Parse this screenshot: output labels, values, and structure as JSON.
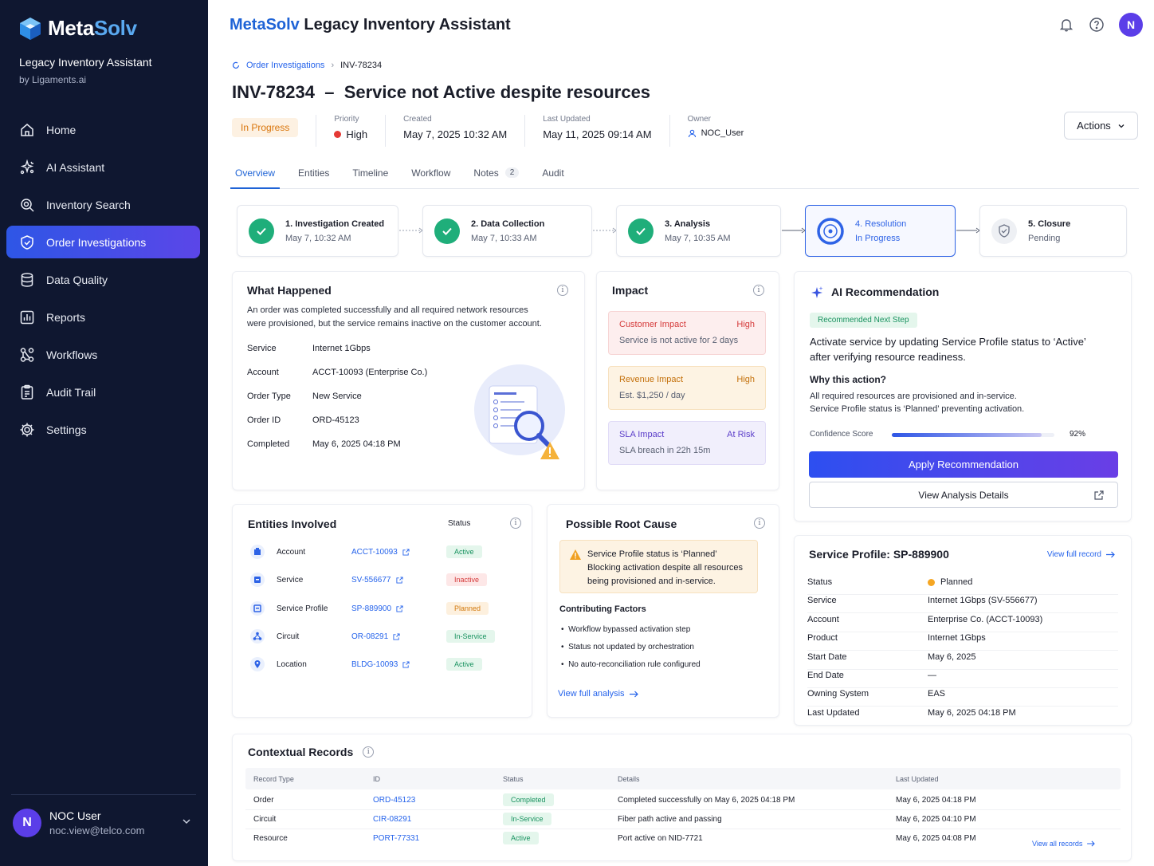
{
  "brand": {
    "meta": "Meta",
    "solv": "Solv",
    "subtitle": "Legacy Inventory Assistant",
    "by": "by Ligaments.ai"
  },
  "nav": [
    {
      "label": "Home",
      "icon": "home-icon"
    },
    {
      "label": "AI Assistant",
      "icon": "ai-assistant-icon"
    },
    {
      "label": "Inventory Search",
      "icon": "search-icon"
    },
    {
      "label": "Order Investigations",
      "icon": "shield-icon",
      "active": true
    },
    {
      "label": "Data Quality",
      "icon": "database-icon"
    },
    {
      "label": "Reports",
      "icon": "reports-icon"
    },
    {
      "label": "Workflows",
      "icon": "workflows-icon"
    },
    {
      "label": "Audit Trail",
      "icon": "audit-icon"
    },
    {
      "label": "Settings",
      "icon": "gear-icon"
    }
  ],
  "user": {
    "initial": "N",
    "name": "NOC User",
    "email": "noc.view@telco.com"
  },
  "header": {
    "brand": "MetaSolv",
    "title": "Legacy Inventory Assistant",
    "avatar": "N"
  },
  "breadcrumb": {
    "parent": "Order Investigations",
    "current": "INV-78234"
  },
  "investigation": {
    "id": "INV-78234",
    "dash": "–",
    "title": "Service not Active despite resources",
    "status": "In Progress",
    "priority_label": "Priority",
    "priority": "High",
    "created_label": "Created",
    "created": "May 7, 2025 10:32 AM",
    "updated_label": "Last Updated",
    "updated": "May 11, 2025 09:14 AM",
    "owner_label": "Owner",
    "owner": "NOC_User",
    "actions": "Actions"
  },
  "tabs": [
    {
      "label": "Overview",
      "active": true
    },
    {
      "label": "Entities"
    },
    {
      "label": "Timeline"
    },
    {
      "label": "Workflow"
    },
    {
      "label": "Notes",
      "count": "2"
    },
    {
      "label": "Audit"
    }
  ],
  "steps": [
    {
      "title": "1. Investigation Created",
      "sub": "May 7, 10:32 AM"
    },
    {
      "title": "2. Data Collection",
      "sub": "May 7, 10:33 AM"
    },
    {
      "title": "3. Analysis",
      "sub": "May 7, 10:35 AM"
    },
    {
      "title": "4. Resolution",
      "sub": "In Progress"
    },
    {
      "title": "5. Closure",
      "sub": "Pending"
    }
  ],
  "what_happened": {
    "title": "What Happened",
    "desc1": "An order was completed successfully and all required network resources",
    "desc2": "were provisioned, but the service remains inactive on the customer account.",
    "rows": [
      {
        "k": "Service",
        "v": "Internet 1Gbps"
      },
      {
        "k": "Account",
        "v": "ACCT-10093 (Enterprise Co.)"
      },
      {
        "k": "Order Type",
        "v": "New Service"
      },
      {
        "k": "Order ID",
        "v": "ORD-45123"
      },
      {
        "k": "Completed",
        "v": "May 6, 2025 04:18 PM"
      }
    ]
  },
  "impact": {
    "title": "Impact",
    "items": [
      {
        "name": "Customer Impact",
        "level": "High",
        "desc": "Service is not active for 2 days",
        "color": "#d53b3b"
      },
      {
        "name": "Revenue Impact",
        "level": "High",
        "desc": "Est. $1,250 / day",
        "color": "#d27a0e"
      },
      {
        "name": "SLA Impact",
        "level": "At Risk",
        "desc": "SLA breach in 22h 15m",
        "color": "#5b3ec9"
      }
    ]
  },
  "ai": {
    "title": "AI Recommendation",
    "tag": "Recommended Next Step",
    "rec1": "Activate service by updating Service Profile status to ‘Active’",
    "rec2": "after verifying resource readiness.",
    "why": "Why this action?",
    "why1": "All required resources are provisioned and in-service.",
    "why2": "Service Profile status is ‘Planned’ preventing activation.",
    "conf_label": "Confidence Score",
    "confidence": 0.92,
    "conf_text": "92%",
    "apply": "Apply Recommendation",
    "details": "View Analysis Details"
  },
  "entities": {
    "title": "Entities Involved",
    "status_header": "Status",
    "rows": [
      {
        "name": "Account",
        "id": "ACCT-10093",
        "status": "Active",
        "cls": "g",
        "icon": "building-icon"
      },
      {
        "name": "Service",
        "id": "SV-556677",
        "status": "Inactive",
        "cls": "r",
        "icon": "service-icon"
      },
      {
        "name": "Service Profile",
        "id": "SP-889900",
        "status": "Planned",
        "cls": "o",
        "icon": "profile-icon"
      },
      {
        "name": "Circuit",
        "id": "OR-08291",
        "status": "In-Service",
        "cls": "g",
        "icon": "circuit-icon"
      },
      {
        "name": "Location",
        "id": "BLDG-10093",
        "status": "Active",
        "cls": "g",
        "icon": "location-pin-icon"
      }
    ]
  },
  "root_cause": {
    "title": "Possible Root Cause",
    "alert1": "Service Profile status is ‘Planned’",
    "alert2": "Blocking activation despite all resources",
    "alert3": "being provisioned and in-service.",
    "factors_title": "Contributing Factors",
    "factors": [
      "Workflow bypassed activation step",
      "Status not updated by orchestration",
      "No auto-reconciliation rule configured"
    ],
    "link": "View full analysis"
  },
  "service_profile": {
    "title": "Service Profile: SP-889900",
    "link": "View full record",
    "rows": [
      {
        "k": "Status",
        "v": "Planned"
      },
      {
        "k": "Service",
        "v": "Internet 1Gbps (SV-556677)"
      },
      {
        "k": "Account",
        "v": "Enterprise Co. (ACCT-10093)"
      },
      {
        "k": "Product",
        "v": "Internet 1Gbps"
      },
      {
        "k": "Start Date",
        "v": "May 6, 2025"
      },
      {
        "k": "End Date",
        "v": "—"
      },
      {
        "k": "Owning System",
        "v": "EAS"
      },
      {
        "k": "Last Updated",
        "v": "May 6, 2025 04:18 PM"
      }
    ]
  },
  "contextual": {
    "title": "Contextual Records",
    "headers": [
      "Record Type",
      "ID",
      "Status",
      "Details",
      "Last Updated"
    ],
    "rows": [
      {
        "type": "Order",
        "id": "ORD-45123",
        "status": "Completed",
        "details": "Completed successfully on May 6, 2025 04:18 PM",
        "updated": "May 6, 2025 04:18 PM"
      },
      {
        "type": "Circuit",
        "id": "CIR-08291",
        "status": "In-Service",
        "details": "Fiber path active and passing",
        "updated": "May 6, 2025 04:10 PM"
      },
      {
        "type": "Resource",
        "id": "PORT-77331",
        "status": "Active",
        "details": "Port active on NID-7721",
        "updated": "May 6, 2025 04:08 PM"
      }
    ],
    "link": "View all records"
  }
}
